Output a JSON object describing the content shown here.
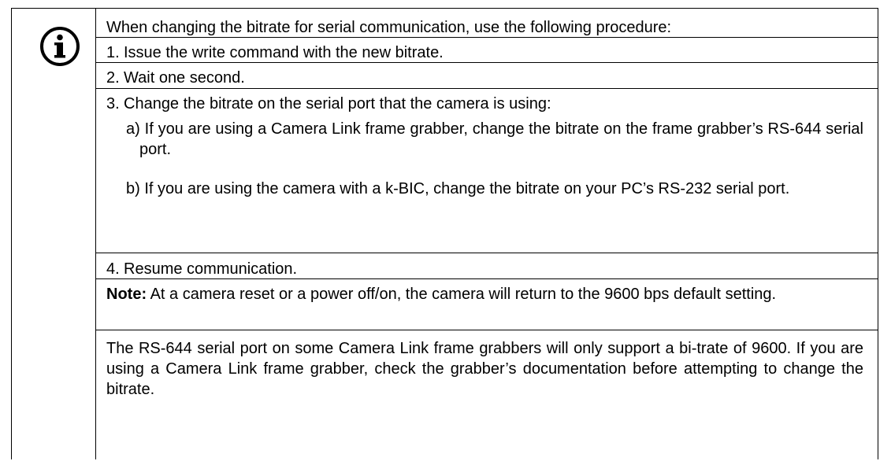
{
  "intro": "When changing the bitrate for serial communication, use the following procedure:",
  "steps": [
    {
      "number": "1.",
      "text": "Issue the write command with the new bitrate."
    },
    {
      "number": "2.",
      "text": "Wait one second."
    },
    {
      "number": "3.",
      "text": "Change the bitrate on the serial port that the camera is using:"
    }
  ],
  "substeps": [
    {
      "letter": "a)",
      "text": "If you are using a Camera Link frame grabber, change the bitrate on the frame grabber’s RS-644 serial port."
    },
    {
      "letter": "b)",
      "text": "If you are using the camera with a k-BIC, change the bitrate on your PC’s RS-232 serial port."
    }
  ],
  "step4": {
    "number": "4.",
    "text": "Resume communication."
  },
  "note": {
    "label": "Note:",
    "text": "At a camera reset or a power off/on, the camera will return to the 9600 bps default setting."
  },
  "closing": "The RS-644 serial port on some Camera Link frame grabbers will only support a bi-trate of 9600. If you are using a Camera Link frame grabber, check the grabber’s documentation before attempting to change the bitrate.",
  "icon": "info-circle-icon"
}
